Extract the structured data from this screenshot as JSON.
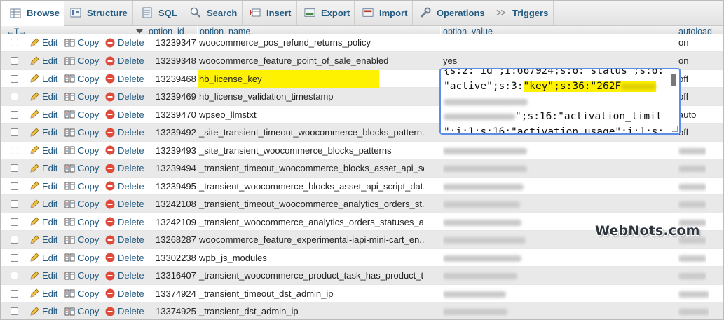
{
  "tabs": [
    {
      "label": "Browse",
      "icon": "browse-icon",
      "active": true
    },
    {
      "label": "Structure",
      "icon": "structure-icon"
    },
    {
      "label": "SQL",
      "icon": "sql-icon"
    },
    {
      "label": "Search",
      "icon": "search-icon"
    },
    {
      "label": "Insert",
      "icon": "insert-icon"
    },
    {
      "label": "Export",
      "icon": "export-icon"
    },
    {
      "label": "Import",
      "icon": "import-icon"
    },
    {
      "label": "Operations",
      "icon": "operations-icon"
    },
    {
      "label": "Triggers",
      "icon": "triggers-icon"
    }
  ],
  "columns": {
    "arrows": "←T→",
    "option_id": "option_id",
    "option_name": "option_name",
    "option_value": "option_value",
    "autoload": "autoload"
  },
  "actions": {
    "edit": "Edit",
    "copy": "Copy",
    "delete": "Delete"
  },
  "rows": [
    {
      "id": "13239347",
      "name": "woocommerce_pos_refund_returns_policy",
      "value": "",
      "autoload": "on"
    },
    {
      "id": "13239348",
      "name": "woocommerce_feature_point_of_sale_enabled",
      "value": "yes",
      "autoload": "on"
    },
    {
      "id": "13239468",
      "name": "hb_license_key",
      "value": "",
      "autoload": "off",
      "highlight": true
    },
    {
      "id": "13239469",
      "name": "hb_license_validation_timestamp",
      "value": "",
      "autoload": "off"
    },
    {
      "id": "13239470",
      "name": "wpseo_llmstxt",
      "value": "",
      "autoload": "auto"
    },
    {
      "id": "13239492",
      "name": "_site_transient_timeout_woocommerce_blocks_pattern...",
      "value": "",
      "autoload": "off"
    },
    {
      "id": "13239493",
      "name": "_site_transient_woocommerce_blocks_patterns",
      "value": "",
      "autoload": ""
    },
    {
      "id": "13239494",
      "name": "_transient_timeout_woocommerce_blocks_asset_api_sc...",
      "value": "",
      "autoload": ""
    },
    {
      "id": "13239495",
      "name": "_transient_woocommerce_blocks_asset_api_script_dat...",
      "value": "",
      "autoload": ""
    },
    {
      "id": "13242108",
      "name": "_transient_timeout_woocommerce_analytics_orders_st...",
      "value": "",
      "autoload": ""
    },
    {
      "id": "13242109",
      "name": "_transient_woocommerce_analytics_orders_statuses_a...",
      "value": "",
      "autoload": ""
    },
    {
      "id": "13268287",
      "name": "woocommerce_feature_experimental-iapi-mini-cart_en...",
      "value": "",
      "autoload": ""
    },
    {
      "id": "13302238",
      "name": "wpb_js_modules",
      "value": "",
      "autoload": ""
    },
    {
      "id": "13316407",
      "name": "_transient_woocommerce_product_task_has_product_tr...",
      "value": "",
      "autoload": ""
    },
    {
      "id": "13374924",
      "name": "_transient_timeout_dst_admin_ip",
      "value": "",
      "autoload": ""
    },
    {
      "id": "13374925",
      "name": "_transient_dst_admin_ip",
      "value": "",
      "autoload": ""
    }
  ],
  "editor": {
    "line1": "{s:2:\"id\";i:667924;s:6:\"status\";s:6:",
    "line2_pre": "\"active\";s:3:",
    "line2_mark": "\"key\";s:36:\"262F",
    "line4_post": "\";s:16:\"activation_limit",
    "line5": "\";i:1;s:16:\"activation_usage\";i:1;s:"
  },
  "watermark": "WebNots.com",
  "colors": {
    "link": "#235a81",
    "highlight": "#fff200",
    "editor_border": "#5b8ee6",
    "row_alt": "#e9e9e9"
  }
}
